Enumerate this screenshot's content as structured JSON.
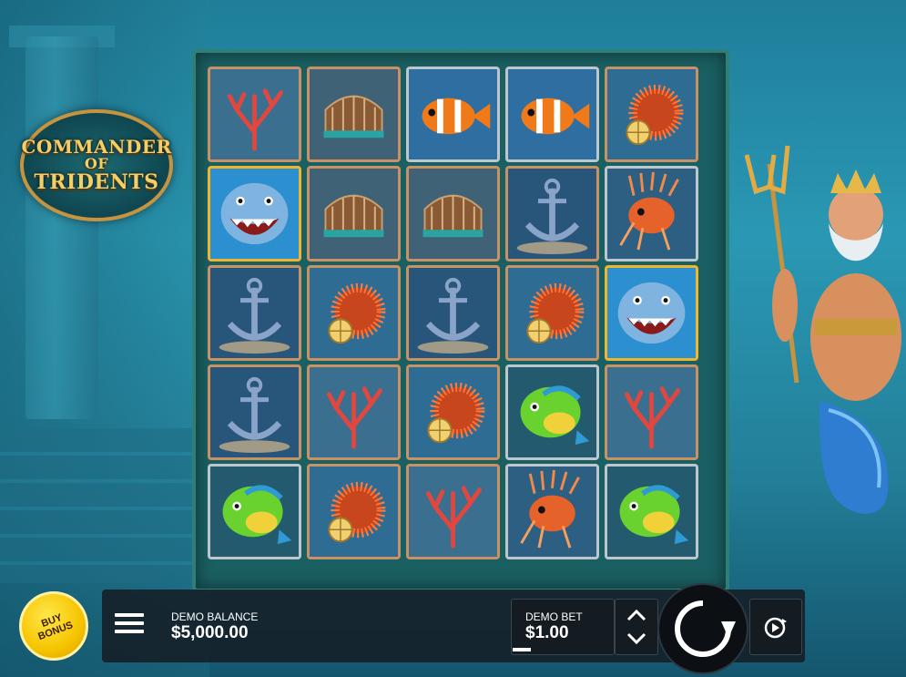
{
  "game": {
    "logo_line1": "COMMANDER",
    "logo_line2": "OF",
    "logo_line3": "TRIDENTS"
  },
  "grid": {
    "rows": [
      [
        "coral",
        "lobster-trap",
        "clownfish",
        "clownfish",
        "sea-urchin"
      ],
      [
        "shark-wild",
        "lobster-trap",
        "lobster-trap",
        "anchor",
        "lionfish"
      ],
      [
        "anchor",
        "sea-urchin",
        "anchor",
        "sea-urchin",
        "shark-wild"
      ],
      [
        "anchor",
        "coral",
        "sea-urchin",
        "mahi-fish",
        "coral"
      ],
      [
        "mahi-fish",
        "sea-urchin",
        "coral",
        "lionfish",
        "mahi-fish"
      ]
    ]
  },
  "controls": {
    "buy_bonus_label": "BUY BONUS",
    "balance_label": "DEMO BALANCE",
    "balance_value": "$5,000.00",
    "bet_label": "DEMO BET",
    "bet_value": "$1.00"
  },
  "icons": {
    "menu": "hamburger-menu-icon",
    "bet_adjust": "chevron-up-down-icon",
    "spin": "spin-arrow-icon",
    "autoplay": "autoplay-icon"
  },
  "colors": {
    "buy_bonus": "#f6c400",
    "cell_border_bronze": "#c99264",
    "cell_border_silver": "#bcc6cc",
    "cell_border_gold": "#f0b52a"
  }
}
